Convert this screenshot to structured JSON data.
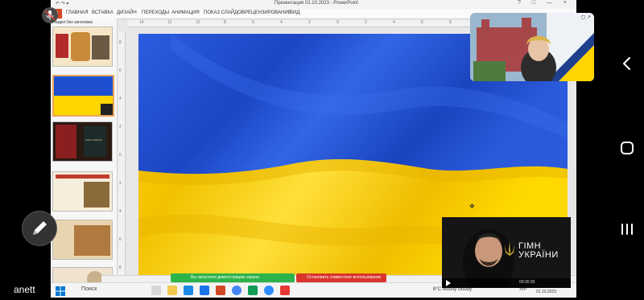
{
  "window": {
    "title": "Презентация 02.10.2023 - PowerPoint",
    "quick_access": "↶ ↷ ▾",
    "controls": "? □ — ×"
  },
  "ribbon": {
    "file_tab": "Ф",
    "tabs": [
      "ГЛАВНАЯ",
      "ВСТАВКА",
      "ДИЗАЙН",
      "ПЕРЕХОДЫ",
      "АНИМАЦИЯ",
      "ПОКАЗ СЛАЙДОВ",
      "РЕЦЕНЗИРОВАНИЕ",
      "ВИД"
    ]
  },
  "slides_panel": {
    "section_label": "Раздел без заголовка",
    "thumb_caption": "ГІМН УКРАЇНИ"
  },
  "rulers": {
    "top_ticks": [
      "14",
      "12",
      "10",
      "8",
      "6",
      "4",
      "2",
      "0",
      "2",
      "4",
      "6",
      "8",
      "10",
      "12",
      "14"
    ],
    "left_ticks": [
      "8",
      "6",
      "4",
      "2",
      "0",
      "2",
      "4",
      "6",
      "8"
    ]
  },
  "share": {
    "started_text": "Вы запустили демонстрацию экрана",
    "stop_text": "Остановить совместное использование"
  },
  "taskbar": {
    "search_label": "Поиск",
    "weather": "8°C  Mostly cloudy",
    "lang": "УКР",
    "time": "09:47",
    "date": "01.10.2023"
  },
  "video": {
    "title_line1": "ГІМН",
    "title_line2": "УКРАЇНИ",
    "time": "00:00:30"
  },
  "overlay": {
    "participant_name": "anett"
  },
  "colors": {
    "flag_blue": "#1f4fd1",
    "flag_yellow": "#ffd500",
    "share_green": "#2db34a",
    "share_red": "#d9342b",
    "ppt_orange": "#d24726"
  },
  "icons": {
    "mic": "mic-off-icon",
    "pen": "pen-icon",
    "back": "nav-back-icon",
    "home": "nav-home-icon",
    "recents": "nav-recents-icon"
  }
}
